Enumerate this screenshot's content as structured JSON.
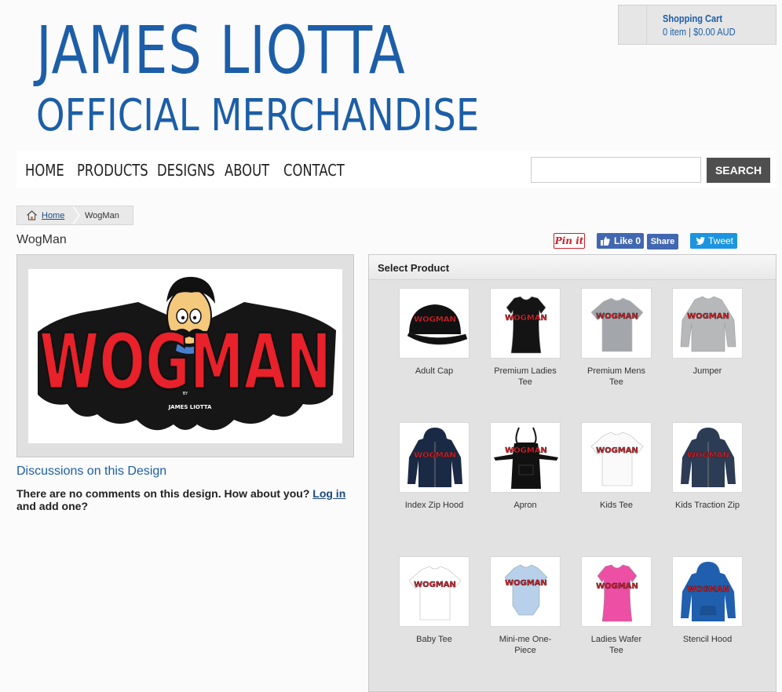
{
  "brand": {
    "line1": "JAMES LIOTTA",
    "line2": "OFFICIAL MERCHANDISE",
    "color": "#1c5ea8"
  },
  "cart": {
    "title": "Shopping Cart",
    "summary": "0 item | $0.00 AUD",
    "icon": "cart-icon"
  },
  "nav": {
    "items": [
      "HOME",
      "PRODUCTS",
      "DESIGNS",
      "ABOUT",
      "CONTACT"
    ]
  },
  "search": {
    "placeholder": "",
    "value": "",
    "button_label": "SEARCH"
  },
  "breadcrumb": {
    "home": "Home",
    "current": "WogMan"
  },
  "design": {
    "title": "WogMan",
    "image_text": "WOGMAN",
    "image_signature": "JAMES LIOTTA",
    "image_signature_prefix": "BY"
  },
  "share": {
    "pinterest": "Pin it",
    "fb_like": "Like 0",
    "fb_share": "Share",
    "tweet": "Tweet"
  },
  "discussion": {
    "title": "Discussions on this Design",
    "text_before": "There are no comments on this design. How about you? ",
    "link": "Log in",
    "text_after": " and add one?"
  },
  "products": {
    "title": "Select Product",
    "items": [
      {
        "label": "Adult Cap",
        "garment": "cap",
        "color": "#111111"
      },
      {
        "label": "Premium Ladies Tee",
        "garment": "ladies-tee",
        "color": "#141414"
      },
      {
        "label": "Premium Mens Tee",
        "garment": "tee",
        "color": "#a3a6aa"
      },
      {
        "label": "Jumper",
        "garment": "jumper",
        "color": "#b7b8ba"
      },
      {
        "label": "Index Zip Hood",
        "garment": "zip-hood",
        "color": "#1b2a44"
      },
      {
        "label": "Apron",
        "garment": "apron",
        "color": "#111111"
      },
      {
        "label": "Kids Tee",
        "garment": "tee",
        "color": "#fafafa"
      },
      {
        "label": "Kids Traction Zip",
        "garment": "zip-hood",
        "color": "#2d3c55"
      },
      {
        "label": "Baby Tee",
        "garment": "tee",
        "color": "#ffffff"
      },
      {
        "label": "Mini-me One-Piece",
        "garment": "onesie",
        "color": "#b8d0ea"
      },
      {
        "label": "Ladies Wafer Tee",
        "garment": "ladies-tee",
        "color": "#ec4fa4"
      },
      {
        "label": "Stencil Hood",
        "garment": "hood",
        "color": "#1f5fae"
      }
    ]
  }
}
